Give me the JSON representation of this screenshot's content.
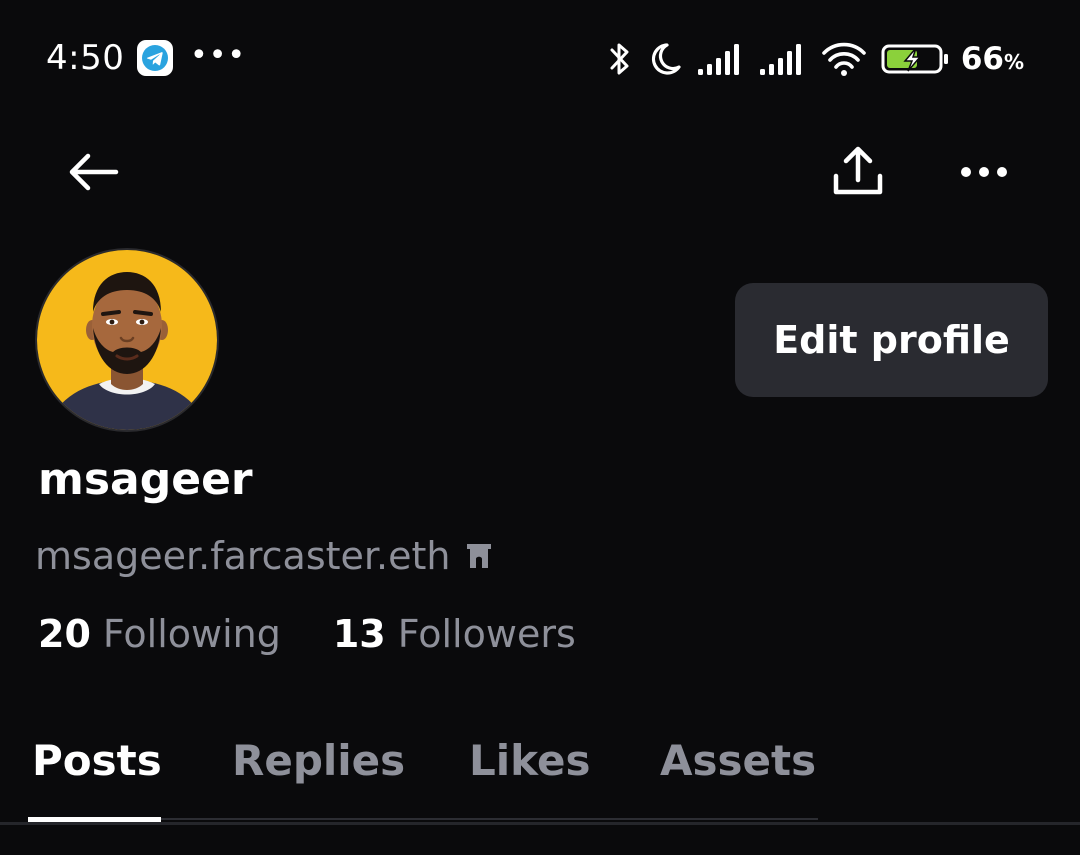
{
  "status_bar": {
    "time": "4:50",
    "more_indicator": "•••",
    "battery_percent": "66",
    "percent_sign": "%",
    "icons": [
      "telegram-icon",
      "bluetooth-icon",
      "moon-icon",
      "signal-icon",
      "signal-icon",
      "wifi-icon",
      "battery-charging-icon"
    ]
  },
  "header": {
    "back_icon": "arrow-left-icon",
    "share_icon": "share-upload-icon",
    "more_icon": "more-horizontal-icon"
  },
  "profile": {
    "display_name": "msageer",
    "handle": "msageer.farcaster.eth",
    "badge_icon": "farcaster-arch-icon",
    "edit_button_label": "Edit profile",
    "following_count": "20",
    "following_label": "Following",
    "followers_count": "13",
    "followers_label": "Followers",
    "avatar_bg": "#f6b91a"
  },
  "tabs": [
    {
      "label": "Posts",
      "active": true
    },
    {
      "label": "Replies",
      "active": false
    },
    {
      "label": "Likes",
      "active": false
    },
    {
      "label": "Assets",
      "active": false
    }
  ],
  "colors": {
    "background": "#0a0a0c",
    "button_bg": "#2a2b31",
    "muted_text": "#8e909a",
    "battery_green": "#8bd13b",
    "telegram_blue": "#2aa3df"
  }
}
